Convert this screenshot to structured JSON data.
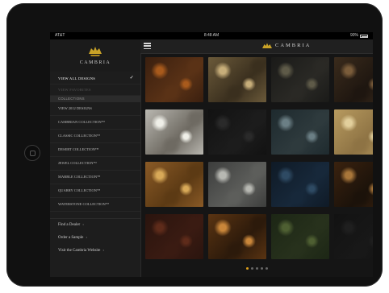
{
  "status_bar": {
    "carrier": "AT&T",
    "time": "8:48 AM",
    "battery": "90%"
  },
  "brand": {
    "name": "Cambria",
    "logo_text": "CAMBRIA",
    "top_text": "CAMBRIA",
    "accent": "#c9a227"
  },
  "sidebar": {
    "view_all": "VIEW ALL DESIGNS",
    "faint_item": "VIEW FAVORITES",
    "collections_header": "COLLECTIONS",
    "collections": [
      "VIEW 2012 DESIGNS",
      "CAMBRIAN COLLECTION™",
      "CLASSIC COLLECTION™",
      "DESERT COLLECTION™",
      "JEWEL COLLECTION™",
      "MARBLE COLLECTION™",
      "QUARRY COLLECTION™",
      "WATERSTONE COLLECTION™"
    ],
    "links": [
      "Find a Dealer",
      "Order a Sample",
      "Visit the Cambria Website"
    ]
  },
  "grid": {
    "tiles": [
      {
        "name": "swatch-1",
        "colors": [
          "#3a1f0f",
          "#a85a1c",
          "#5a3216"
        ]
      },
      {
        "name": "swatch-2",
        "colors": [
          "#6b5a3a",
          "#c7ae7a",
          "#3a2f1e"
        ]
      },
      {
        "name": "swatch-3",
        "colors": [
          "#1a1a18",
          "#5e5a48",
          "#2a2925"
        ]
      },
      {
        "name": "swatch-4",
        "colors": [
          "#3a2b1c",
          "#7a5c3a",
          "#1e1610"
        ]
      },
      {
        "name": "swatch-5",
        "colors": [
          "#b9b7b0",
          "#efefe8",
          "#6e6a62"
        ]
      },
      {
        "name": "swatch-6",
        "colors": [
          "#121212",
          "#2a2a2a",
          "#1c1c1c"
        ]
      },
      {
        "name": "swatch-7",
        "colors": [
          "#1e2a2e",
          "#6b7f85",
          "#2e3a3d"
        ]
      },
      {
        "name": "swatch-8",
        "colors": [
          "#b79a5f",
          "#e2cf9c",
          "#8e7344"
        ]
      },
      {
        "name": "swatch-9",
        "colors": [
          "#8a5a26",
          "#d8a958",
          "#5c3a14"
        ]
      },
      {
        "name": "swatch-10",
        "colors": [
          "#3c3d3c",
          "#b7b8b2",
          "#5d5e5b"
        ]
      },
      {
        "name": "swatch-11",
        "colors": [
          "#0f1a26",
          "#2e4a63",
          "#17283a"
        ]
      },
      {
        "name": "swatch-12",
        "colors": [
          "#3a220f",
          "#a8763a",
          "#1b120a"
        ]
      },
      {
        "name": "swatch-13",
        "colors": [
          "#2a140e",
          "#5e2b1a",
          "#3a1b12"
        ]
      },
      {
        "name": "swatch-14",
        "colors": [
          "#5a3412",
          "#c9863a",
          "#2c1a0b"
        ]
      },
      {
        "name": "swatch-15",
        "colors": [
          "#1c2615",
          "#4e5f32",
          "#27311c"
        ]
      },
      {
        "name": "swatch-16",
        "colors": [
          "#121212",
          "#1f1f1f",
          "#181818"
        ]
      }
    ]
  },
  "pager": {
    "count": 5,
    "active": 0,
    "active_color": "#e0a01a"
  }
}
